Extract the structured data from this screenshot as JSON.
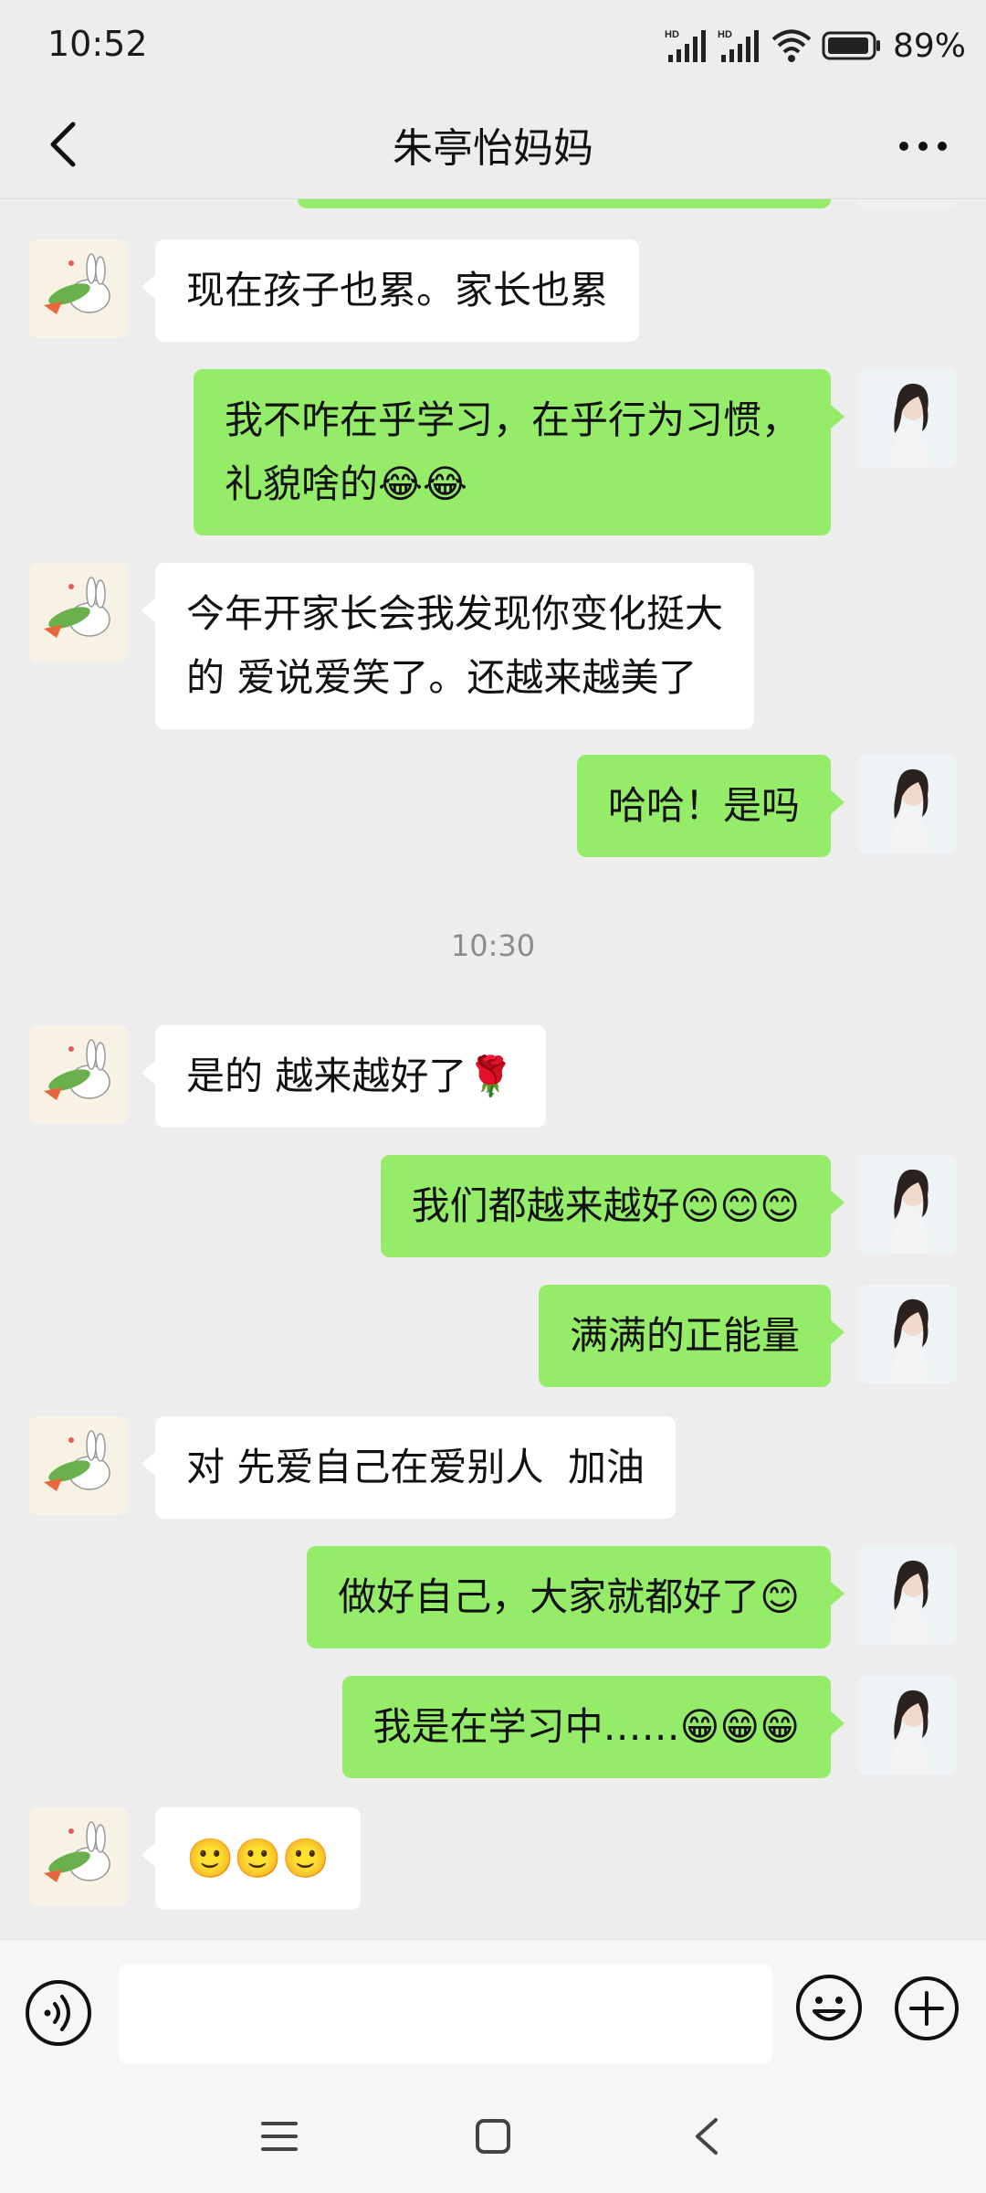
{
  "status_bar": {
    "time": "10:52",
    "battery": "89%",
    "network_1": "HD",
    "network_2": "HD"
  },
  "header": {
    "title": "朱亭怡妈妈"
  },
  "messages": [
    {
      "side": "in",
      "lines": [
        "现在孩子也累。家长也累"
      ]
    },
    {
      "side": "out",
      "lines": [
        "我不咋在乎学习，在乎行为习惯，",
        "礼貌啥的😂😂"
      ]
    },
    {
      "side": "in",
      "lines": [
        "今年开家长会我发现你变化挺大",
        "的 爱说爱笑了。还越来越美了"
      ]
    },
    {
      "side": "out",
      "lines": [
        "哈哈！是吗"
      ]
    },
    {
      "side": "in",
      "lines": [
        "是的 越来越好了🌹"
      ]
    },
    {
      "side": "out",
      "lines": [
        "我们都越来越好😊😊😊"
      ]
    },
    {
      "side": "out",
      "lines": [
        "满满的正能量"
      ]
    },
    {
      "side": "in",
      "lines": [
        "对 先爱自己在爱别人  加油"
      ]
    },
    {
      "side": "out",
      "lines": [
        "做好自己，大家就都好了😊"
      ]
    },
    {
      "side": "out",
      "lines": [
        "我是在学习中……😁😁😁"
      ]
    },
    {
      "side": "in",
      "lines": [
        "🙂🙂🙂"
      ]
    }
  ],
  "timestamp": "10:30",
  "input": {
    "placeholder": ""
  },
  "colors": {
    "outgoing_bubble": "#95EC69",
    "incoming_bubble": "#FFFFFF",
    "background": "#EDEDED"
  }
}
